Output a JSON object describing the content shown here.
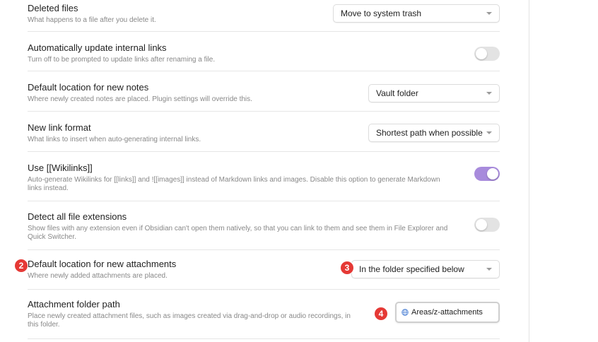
{
  "colors": {
    "accent": "#a88bdc",
    "badge": "#e53935"
  },
  "settings": [
    {
      "name": "Deleted files",
      "desc": "What happens to a file after you delete it.",
      "control": "select",
      "value": "Move to system trash"
    },
    {
      "name": "Automatically update internal links",
      "desc": "Turn off to be prompted to update links after renaming a file.",
      "control": "toggle",
      "enabled": false
    },
    {
      "name": "Default location for new notes",
      "desc": "Where newly created notes are placed. Plugin settings will override this.",
      "control": "select",
      "value": "Vault folder"
    },
    {
      "name": "New link format",
      "desc": "What links to insert when auto-generating internal links.",
      "control": "select",
      "value": "Shortest path when possible"
    },
    {
      "name": "Use [[Wikilinks]]",
      "desc": "Auto-generate Wikilinks for [[links]] and ![[images]] instead of Markdown links and images. Disable this option to generate Markdown links instead.",
      "control": "toggle",
      "enabled": true
    },
    {
      "name": "Detect all file extensions",
      "desc": "Show files with any extension even if Obsidian can't open them natively, so that you can link to them and see them in File Explorer and Quick Switcher.",
      "control": "toggle",
      "enabled": false
    },
    {
      "name": "Default location for new attachments",
      "desc": "Where newly added attachments are placed.",
      "control": "select",
      "value": "In the folder specified below"
    },
    {
      "name": "Attachment folder path",
      "desc": "Place newly created attachment files, such as images created via drag-and-drop or audio recordings, in this folder.",
      "control": "button",
      "value": "Areas/z-attachments"
    }
  ],
  "badges": [
    "2",
    "3",
    "4"
  ]
}
